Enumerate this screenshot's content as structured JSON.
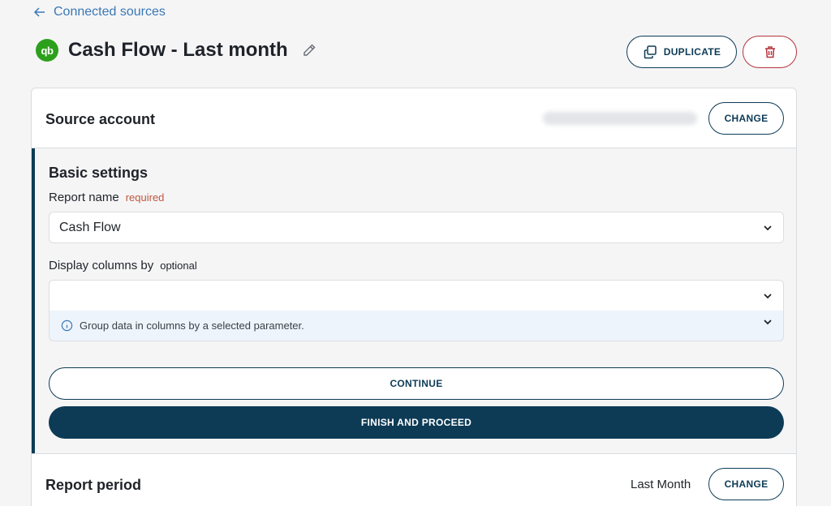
{
  "nav": {
    "back_label": "Connected sources"
  },
  "header": {
    "logo_text": "qb",
    "title": "Cash Flow - Last month",
    "duplicate_label": "DUPLICATE"
  },
  "source_account": {
    "label": "Source account",
    "change_label": "CHANGE"
  },
  "basic_settings": {
    "title": "Basic settings",
    "report_name": {
      "label": "Report name",
      "tag": "required",
      "value": "Cash Flow"
    },
    "display_columns": {
      "label": "Display columns by",
      "tag": "optional",
      "value": "",
      "info": "Group data in columns by a selected parameter."
    },
    "continue_label": "CONTINUE",
    "finish_label": "FINISH AND PROCEED"
  },
  "report_period": {
    "label": "Report period",
    "value": "Last Month",
    "change_label": "CHANGE"
  },
  "colors": {
    "primary": "#0d3b56",
    "link": "#3a78b5",
    "danger": "#b5333b",
    "required": "#c0573e",
    "quickbooks": "#2ca01c"
  }
}
